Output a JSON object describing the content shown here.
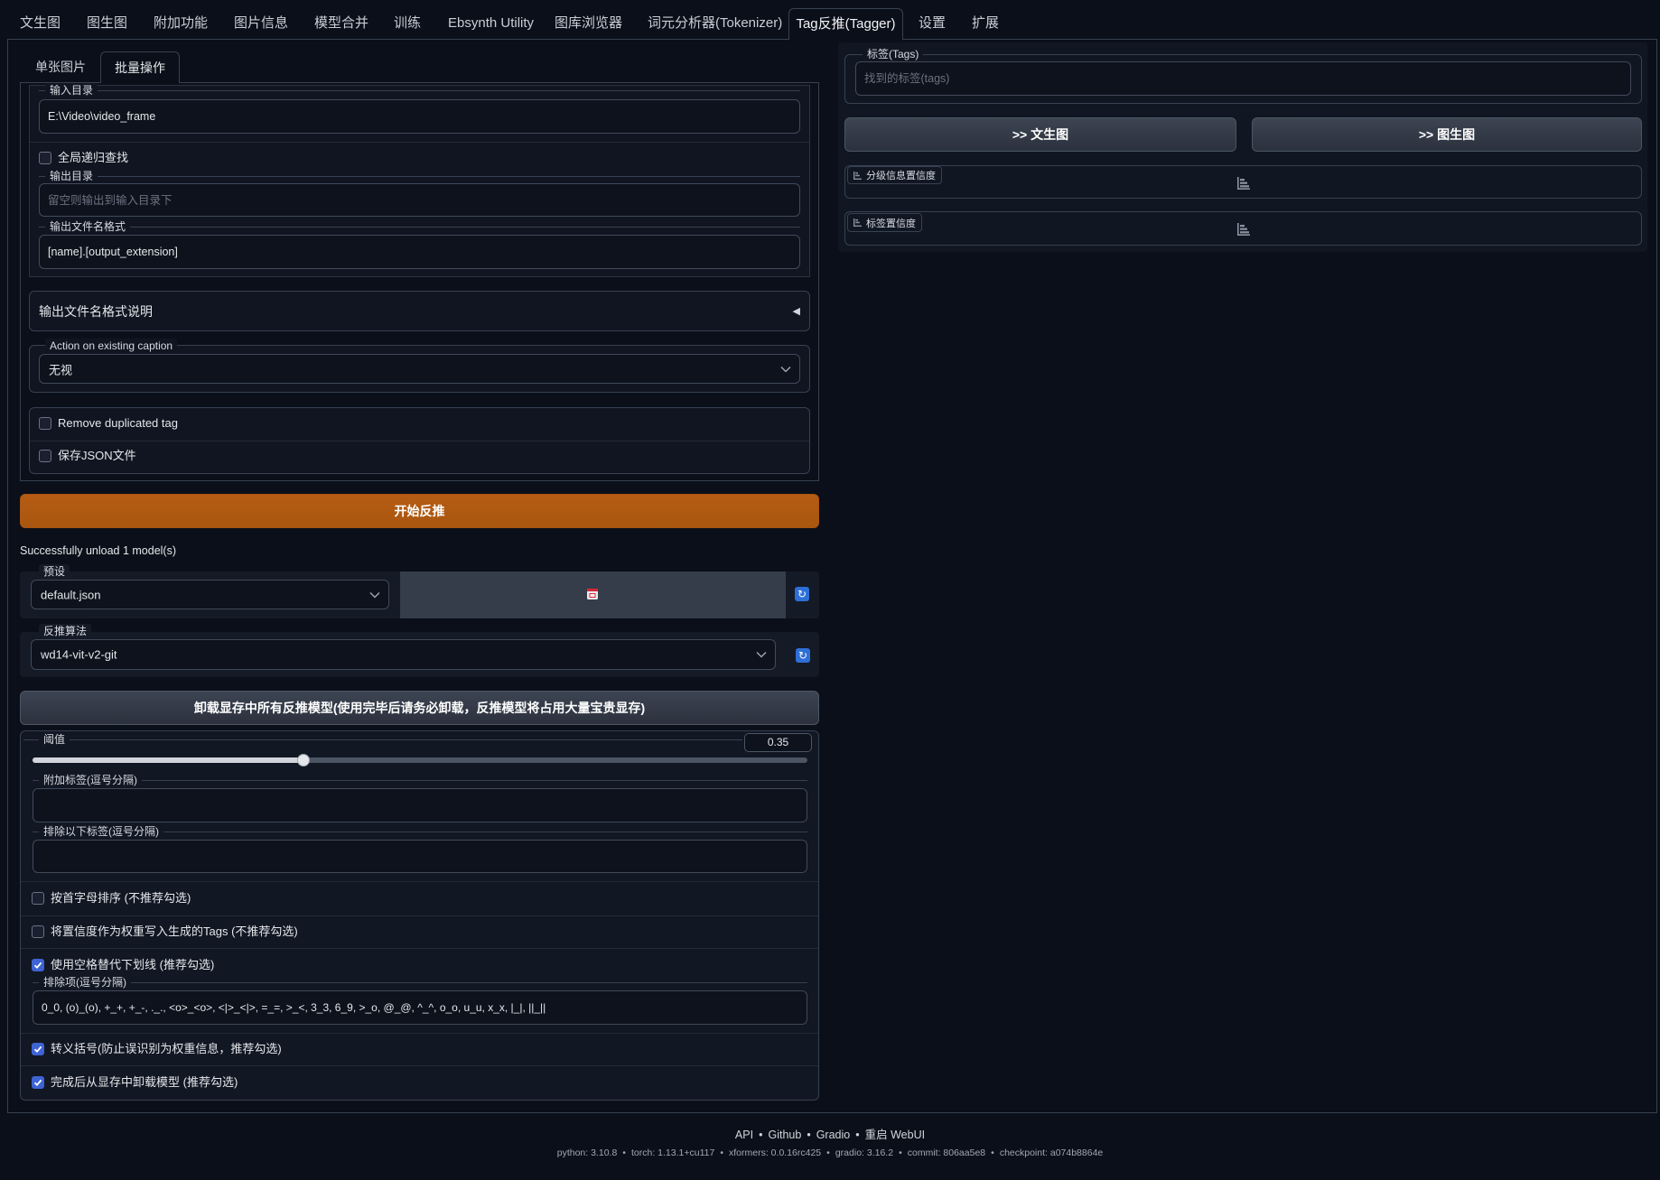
{
  "top_tabs": [
    "文生图",
    "图生图",
    "附加功能",
    "图片信息",
    "模型合并",
    "训练",
    "Ebsynth Utility",
    "图库浏览器",
    "词元分析器(Tokenizer)",
    "Tag反推(Tagger)",
    "设置",
    "扩展"
  ],
  "sub_tabs": [
    "单张图片",
    "批量操作"
  ],
  "batch": {
    "input_dir": {
      "label": "输入目录",
      "value": "E:\\Video\\video_frame"
    },
    "recursive": {
      "label": "全局递归查找",
      "checked": false
    },
    "output_dir": {
      "label": "输出目录",
      "placeholder": "留空则输出到输入目录下"
    },
    "output_filename_format": {
      "label": "输出文件名格式",
      "value": "[name].[output_extension]"
    },
    "format_help_accordion": {
      "label": "输出文件名格式说明",
      "arrow": "◀"
    },
    "caption_action": {
      "label": "Action on existing caption",
      "selected": "无视"
    },
    "remove_duplicated_tag": {
      "label": "Remove duplicated tag",
      "checked": false
    },
    "save_json": {
      "label": "保存JSON文件",
      "checked": false
    }
  },
  "start_button_label": "开始反推",
  "status_message": "Successfully unload 1 model(s)",
  "preset": {
    "label": "预设",
    "selected": "default.json"
  },
  "interrogator": {
    "label": "反推算法",
    "selected": "wd14-vit-v2-git"
  },
  "unload_button_label": "卸载显存中所有反推模型(使用完毕后请务必卸载，反推模型将占用大量宝贵显存)",
  "settings": {
    "threshold": {
      "label": "阈值",
      "value": 0.35
    },
    "additional_tags": {
      "label": "附加标签(逗号分隔)",
      "value": ""
    },
    "exclude_tags": {
      "label": "排除以下标签(逗号分隔)",
      "value": ""
    },
    "sort_by_alphabet": {
      "label": "按首字母排序 (不推荐勾选)",
      "checked": false
    },
    "add_confidence_as_weight": {
      "label": "将置信度作为权重写入生成的Tags (不推荐勾选)",
      "checked": false
    },
    "replace_underscore": {
      "label": "使用空格替代下划线 (推荐勾选)",
      "checked": true
    },
    "underscore_excludes": {
      "label": "排除项(逗号分隔)",
      "value": "0_0, (o)_(o), +_+, +_-, ._., <o>_<o>, <|>_<|>, =_=, >_<, 3_3, 6_9, >_o, @_@, ^_^, o_o, u_u, x_x, |_|, ||_||"
    },
    "escape_brackets": {
      "label": "转义括号(防止误识别为权重信息，推荐勾选)",
      "checked": true
    },
    "unload_after_interrogate": {
      "label": "完成后从显存中卸载模型 (推荐勾选)",
      "checked": true
    }
  },
  "output": {
    "tags": {
      "label": "标签(Tags)",
      "placeholder": "找到的标签(tags)"
    },
    "send_to_txt2img_label": ">> 文生图",
    "send_to_img2img_label": ">> 图生图",
    "rating_confidences_label": "分级信息置信度",
    "tag_confidences_label": "标签置信度"
  },
  "footer": {
    "links": [
      "API",
      "Github",
      "Gradio",
      "重启 WebUI"
    ],
    "separator": "•",
    "versions": [
      "python: 3.10.8",
      "torch: 1.13.1+cu117",
      "xformers: 0.0.16rc425",
      "gradio: 3.16.2",
      "commit: 806aa5e8",
      "checkpoint: a074b8864e"
    ]
  },
  "icons": {
    "refresh": "↻"
  },
  "colors": {
    "accent": "#3f63d3",
    "primary_button": "#a9560f",
    "refresh_button": "#2d6fd6"
  }
}
